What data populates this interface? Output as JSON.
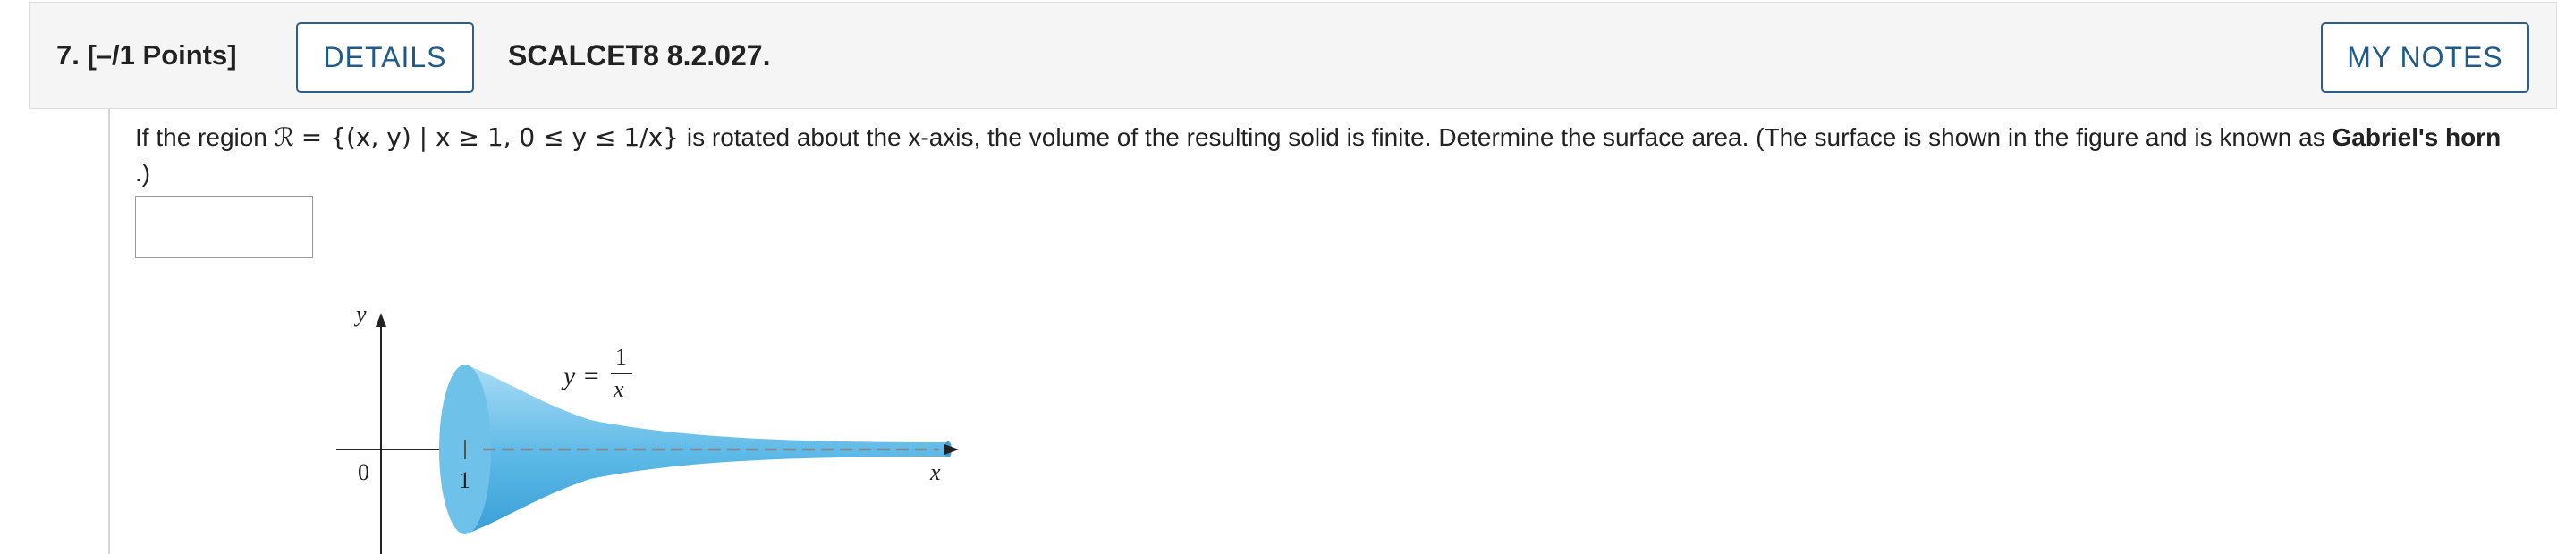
{
  "header": {
    "question_number": "7.",
    "points": "[–/1 Points]",
    "details_label": "DETAILS",
    "question_id": "SCALCET8 8.2.027.",
    "my_notes_label": "MY NOTES"
  },
  "question": {
    "text_part1": "If the region ",
    "region_symbol": "ℛ",
    "set_notation": " = {(x, y) | x ≥ 1, 0 ≤ y ≤ 1/x} ",
    "text_part2": " is rotated about the x-axis, the volume of the resulting solid is finite. Determine the surface area. (The surface is shown in the figure and is known as ",
    "bold_term": "Gabriel's horn",
    "text_part3": ".)",
    "answer_value": ""
  },
  "figure": {
    "y_axis_label": "y",
    "x_axis_label": "x",
    "origin_label": "0",
    "tick_label": "1",
    "equation_lhs": "y =",
    "equation_numerator": "1",
    "equation_denominator": "x",
    "horn_color": "#5bb8e6"
  }
}
